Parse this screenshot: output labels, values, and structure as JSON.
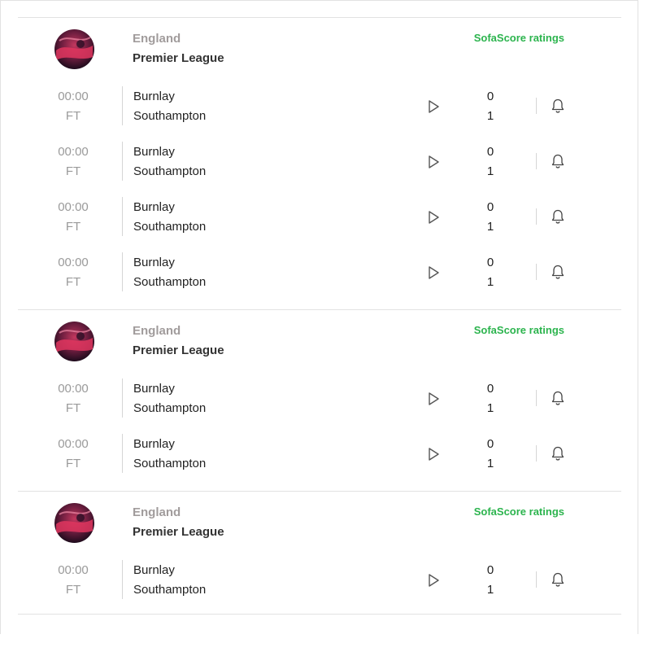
{
  "colors": {
    "ratings_green": "#2cb44e",
    "country_gray": "#a19c9c",
    "time_gray": "#9a9a9a",
    "divider": "#e2e2e2"
  },
  "icons": {
    "play": "play-icon",
    "bell": "bell-icon",
    "league_logo": "league-logo"
  },
  "sections": [
    {
      "country": "England",
      "league": "Premier League",
      "ratings_label": "SofaScore ratings",
      "matches": [
        {
          "time": "00:00",
          "status": "FT",
          "home": "Burnlay",
          "away": "Southampton",
          "home_score": "0",
          "away_score": "1"
        },
        {
          "time": "00:00",
          "status": "FT",
          "home": "Burnlay",
          "away": "Southampton",
          "home_score": "0",
          "away_score": "1"
        },
        {
          "time": "00:00",
          "status": "FT",
          "home": "Burnlay",
          "away": "Southampton",
          "home_score": "0",
          "away_score": "1"
        },
        {
          "time": "00:00",
          "status": "FT",
          "home": "Burnlay",
          "away": "Southampton",
          "home_score": "0",
          "away_score": "1"
        }
      ]
    },
    {
      "country": "England",
      "league": "Premier League",
      "ratings_label": "SofaScore ratings",
      "matches": [
        {
          "time": "00:00",
          "status": "FT",
          "home": "Burnlay",
          "away": "Southampton",
          "home_score": "0",
          "away_score": "1"
        },
        {
          "time": "00:00",
          "status": "FT",
          "home": "Burnlay",
          "away": "Southampton",
          "home_score": "0",
          "away_score": "1"
        }
      ]
    },
    {
      "country": "England",
      "league": "Premier League",
      "ratings_label": "SofaScore ratings",
      "matches": [
        {
          "time": "00:00",
          "status": "FT",
          "home": "Burnlay",
          "away": "Southampton",
          "home_score": "0",
          "away_score": "1"
        }
      ]
    }
  ]
}
